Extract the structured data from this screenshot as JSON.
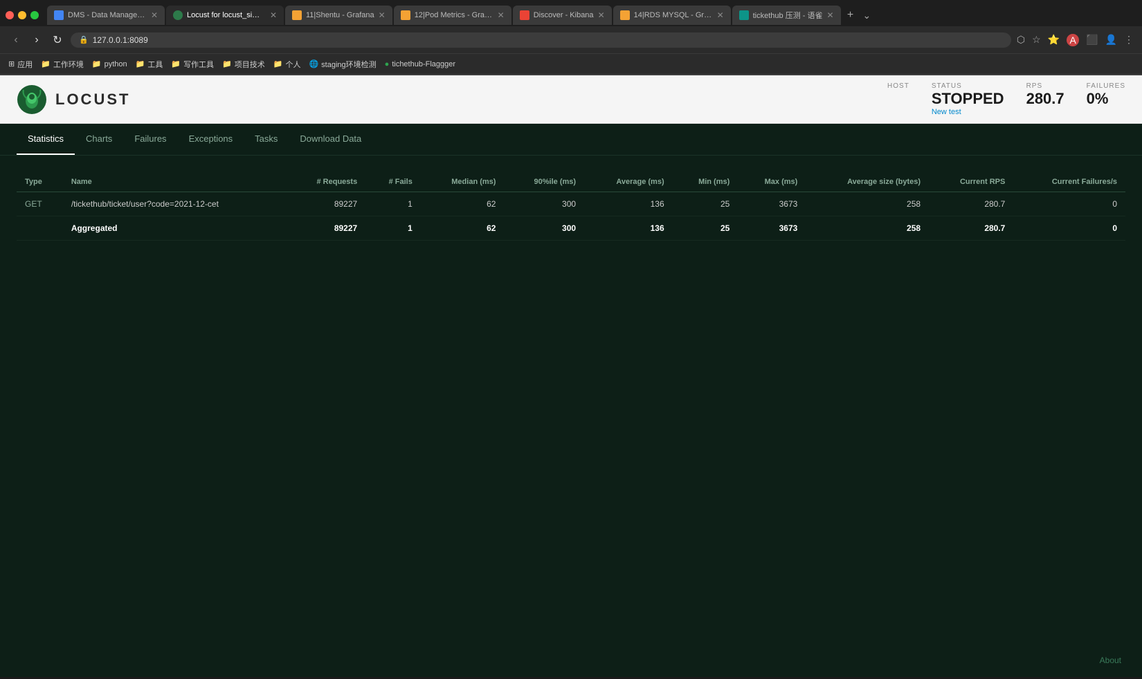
{
  "browser": {
    "tabs": [
      {
        "id": "tab1",
        "label": "DMS - Data Management Se...",
        "favicon_color": "blue",
        "active": false,
        "closable": true
      },
      {
        "id": "tab2",
        "label": "Locust for locust_simple.py",
        "favicon_color": "locust",
        "active": true,
        "closable": true
      },
      {
        "id": "tab3",
        "label": "11|Shentu - Grafana",
        "favicon_color": "orange",
        "active": false,
        "closable": true
      },
      {
        "id": "tab4",
        "label": "12|Pod Metrics - Grafana",
        "favicon_color": "orange",
        "active": false,
        "closable": true
      },
      {
        "id": "tab5",
        "label": "Discover - Kibana",
        "favicon_color": "red",
        "active": false,
        "closable": true
      },
      {
        "id": "tab6",
        "label": "14|RDS MYSQL - Grafana",
        "favicon_color": "orange",
        "active": false,
        "closable": true
      },
      {
        "id": "tab7",
        "label": "tickethub 压测 - 语雀",
        "favicon_color": "teal",
        "active": false,
        "closable": true
      }
    ],
    "url": "127.0.0.1:8089",
    "bookmarks": [
      {
        "icon": "grid",
        "label": "应用"
      },
      {
        "icon": "folder",
        "label": "工作环境"
      },
      {
        "icon": "folder",
        "label": "python"
      },
      {
        "icon": "folder",
        "label": "工具"
      },
      {
        "icon": "folder",
        "label": "写作工具"
      },
      {
        "icon": "folder",
        "label": "项目技术"
      },
      {
        "icon": "folder",
        "label": "个人"
      },
      {
        "icon": "globe",
        "label": "staging环境检测"
      },
      {
        "icon": "dot",
        "label": "tichethub-Flaggger"
      }
    ]
  },
  "app": {
    "logo_text": "LOCUST",
    "header": {
      "host_label": "HOST",
      "host_value": "",
      "status_label": "STATUS",
      "status_value": "STOPPED",
      "new_test_label": "New test",
      "rps_label": "RPS",
      "rps_value": "280.7",
      "failures_label": "FAILURES",
      "failures_value": "0%"
    },
    "nav": {
      "tabs": [
        {
          "id": "statistics",
          "label": "Statistics",
          "active": true
        },
        {
          "id": "charts",
          "label": "Charts",
          "active": false
        },
        {
          "id": "failures",
          "label": "Failures",
          "active": false
        },
        {
          "id": "exceptions",
          "label": "Exceptions",
          "active": false
        },
        {
          "id": "tasks",
          "label": "Tasks",
          "active": false
        },
        {
          "id": "download-data",
          "label": "Download Data",
          "active": false
        }
      ]
    },
    "table": {
      "headers": [
        {
          "id": "type",
          "label": "Type"
        },
        {
          "id": "name",
          "label": "Name"
        },
        {
          "id": "requests",
          "label": "# Requests"
        },
        {
          "id": "fails",
          "label": "# Fails"
        },
        {
          "id": "median",
          "label": "Median (ms)"
        },
        {
          "id": "percentile90",
          "label": "90%ile (ms)"
        },
        {
          "id": "average",
          "label": "Average (ms)"
        },
        {
          "id": "min",
          "label": "Min (ms)"
        },
        {
          "id": "max",
          "label": "Max (ms)"
        },
        {
          "id": "avg_size",
          "label": "Average size (bytes)"
        },
        {
          "id": "current_rps",
          "label": "Current RPS"
        },
        {
          "id": "current_failures",
          "label": "Current Failures/s"
        }
      ],
      "rows": [
        {
          "type": "GET",
          "name": "/tickethub/ticket/user?code=2021-12-cet",
          "requests": "89227",
          "fails": "1",
          "median": "62",
          "percentile90": "300",
          "average": "136",
          "min": "25",
          "max": "3673",
          "avg_size": "258",
          "current_rps": "280.7",
          "current_failures": "0"
        }
      ],
      "aggregated": {
        "type": "",
        "name": "Aggregated",
        "requests": "89227",
        "fails": "1",
        "median": "62",
        "percentile90": "300",
        "average": "136",
        "min": "25",
        "max": "3673",
        "avg_size": "258",
        "current_rps": "280.7",
        "current_failures": "0"
      }
    },
    "about_label": "About"
  }
}
